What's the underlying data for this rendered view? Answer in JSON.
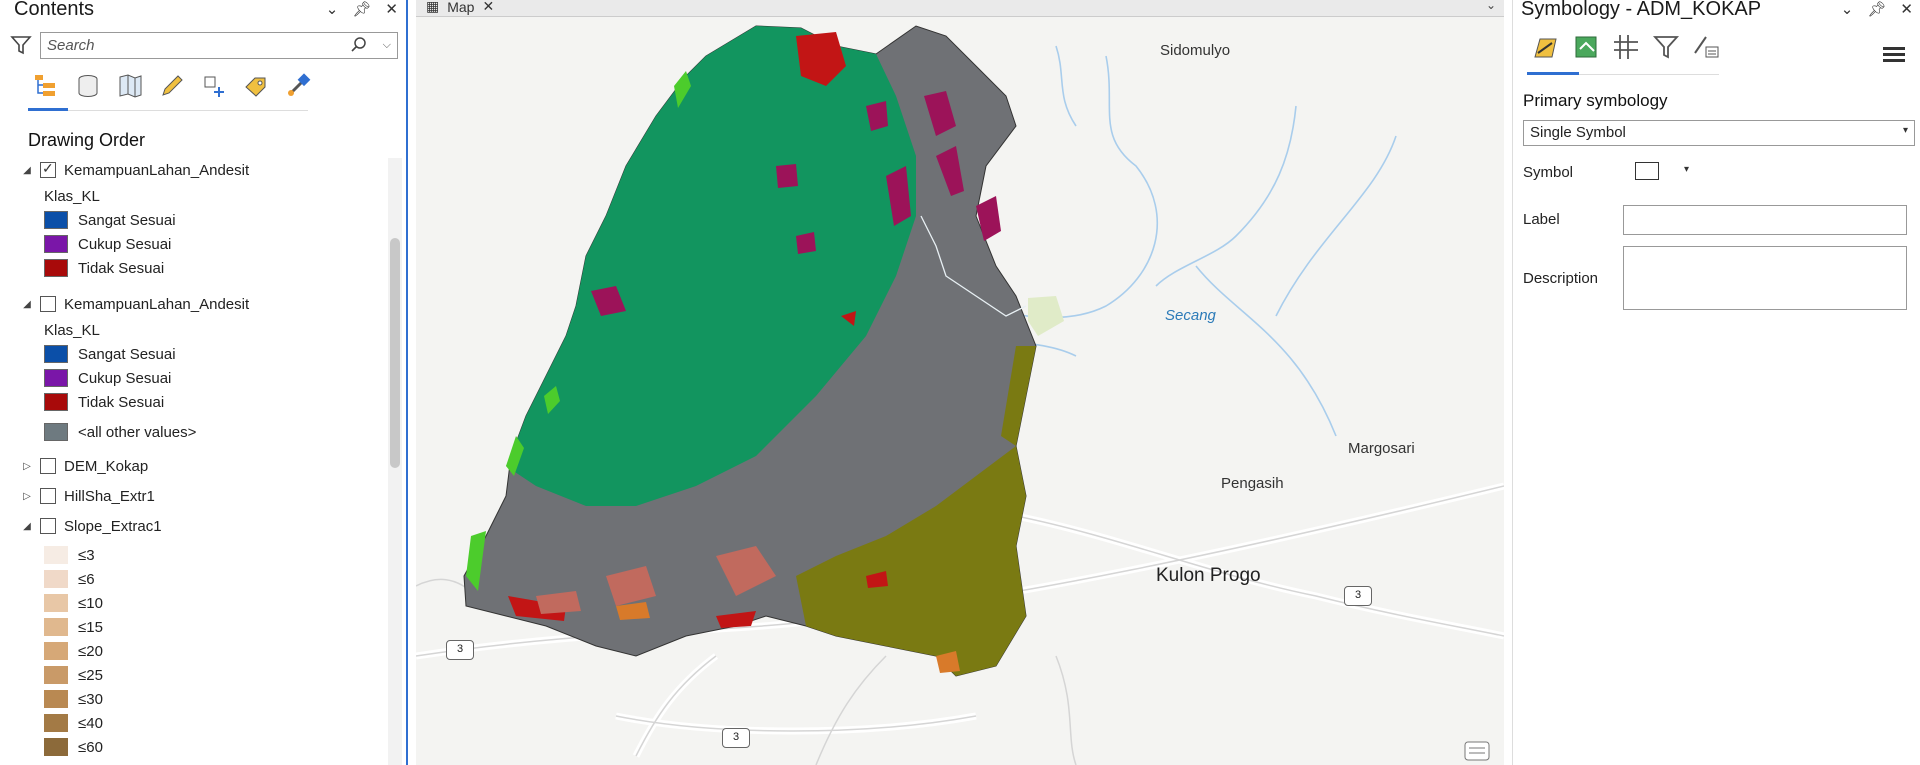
{
  "contents": {
    "title": "Contents",
    "search_placeholder": "Search",
    "drawing_order": "Drawing Order",
    "layers": [
      {
        "name": "KemampuanLahan_Andesit",
        "field": "Klas_KL",
        "classes": [
          "Sangat Sesuai",
          "Cukup Sesuai",
          "Tidak Sesuai"
        ]
      },
      {
        "name": "KemampuanLahan_Andesit",
        "field": "Klas_KL",
        "classes": [
          "Sangat Sesuai",
          "Cukup Sesuai",
          "Tidak Sesuai",
          "<all other values>"
        ]
      },
      {
        "name": "DEM_Kokap"
      },
      {
        "name": "HillSha_Extr1"
      },
      {
        "name": "Slope_Extrac1",
        "classes": [
          "≤3",
          "≤6",
          "≤10",
          "≤15",
          "≤20",
          "≤25",
          "≤30",
          "≤40",
          "≤60"
        ]
      }
    ],
    "colors": {
      "sangat": "#0b4fa8",
      "cukup": "#7a16a8",
      "tidak": "#a80a0a",
      "other": "#6e7a80",
      "slope": [
        "#f6ece4",
        "#f0d9c8",
        "#e8c7a6",
        "#e0b88e",
        "#d6a877",
        "#c99a68",
        "#b98952",
        "#a37a45",
        "#8c6a3a"
      ]
    }
  },
  "map": {
    "tab_label": "Map",
    "places": {
      "sidomulyo": "Sidomulyo",
      "secang": "Secang",
      "margosari": "Margosari",
      "pengasih": "Pengasih",
      "kulon_progo": "Kulon Progo"
    },
    "route_number": "3"
  },
  "symbology": {
    "title": "Symbology - ADM_KOKAP",
    "primary_label": "Primary symbology",
    "primary_value": "Single Symbol",
    "symbol_label": "Symbol",
    "label_label": "Label",
    "label_value": "",
    "description_label": "Description",
    "description_value": ""
  }
}
